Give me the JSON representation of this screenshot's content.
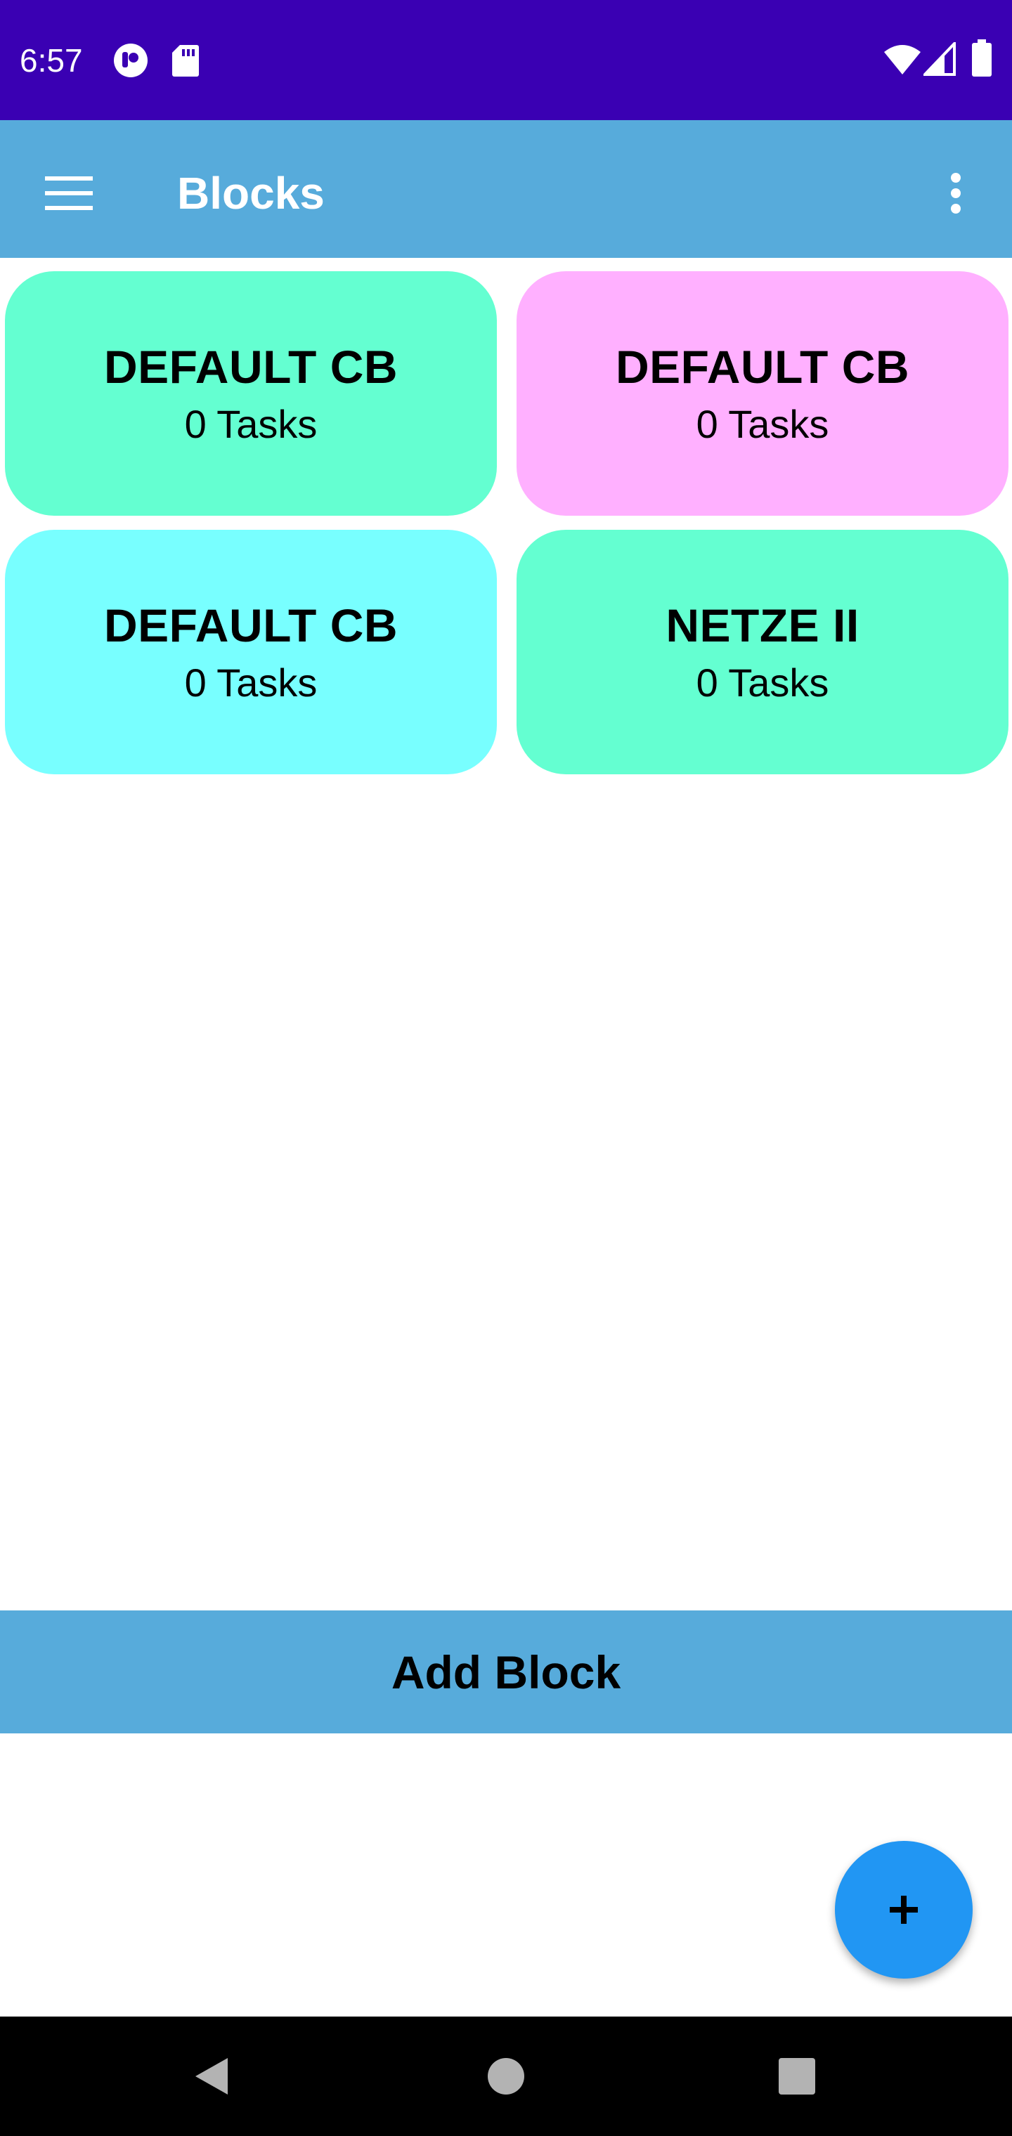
{
  "status_bar": {
    "time": "6:57",
    "icons_left": [
      "app-notification-icon",
      "sd-card-icon"
    ],
    "icons_right": [
      "wifi-icon",
      "cell-signal-icon",
      "battery-icon"
    ],
    "background": "#3a00b3"
  },
  "app_bar": {
    "title": "Blocks",
    "menu_icon": "hamburger-menu-icon",
    "overflow_icon": "more-vertical-icon",
    "background": "#57abdb"
  },
  "blocks": [
    {
      "title": "DEFAULT CB",
      "subtitle": "0 Tasks",
      "color": "#64ffd1"
    },
    {
      "title": "DEFAULT CB",
      "subtitle": "0 Tasks",
      "color": "#ffb0ff"
    },
    {
      "title": "DEFAULT CB",
      "subtitle": "0 Tasks",
      "color": "#78ffff"
    },
    {
      "title": "NETZE II",
      "subtitle": "0 Tasks",
      "color": "#64ffd1"
    }
  ],
  "add_block": {
    "label": "Add Block",
    "background": "#57abdb"
  },
  "fab": {
    "icon": "plus-icon",
    "color": "#2196f3"
  },
  "nav_bar": {
    "icons": [
      "back-icon",
      "home-icon",
      "recents-icon"
    ]
  }
}
